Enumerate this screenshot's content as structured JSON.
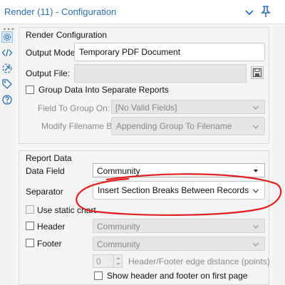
{
  "window": {
    "title": "Render (11) - Configuration"
  },
  "render_config": {
    "section_title": "Render Configuration",
    "output_mode_label": "Output Mode:",
    "output_mode_value": "Temporary PDF Document",
    "output_file_label": "Output File:",
    "output_file_value": "",
    "group_data_label": "Group Data Into Separate Reports",
    "group_data_checked": false,
    "field_to_group_label": "Field To Group On:",
    "field_to_group_value": "[No Valid Fields]",
    "modify_filename_label": "Modify Filename By:",
    "modify_filename_value": "Appending Group To Filename"
  },
  "report_data": {
    "section_title": "Report Data",
    "data_field_label": "Data Field",
    "data_field_value": "Community",
    "separator_label": "Separator",
    "separator_value": "Insert Section Breaks Between Records",
    "static_chart_label": "Use static chart",
    "static_chart_checked": false,
    "header_label": "Header",
    "header_checked": false,
    "header_value": "Community",
    "footer_label": "Footer",
    "footer_checked": false,
    "footer_value": "Community",
    "edge_distance_value": "0",
    "edge_distance_label": "Header/Footer edge distance (points)",
    "show_first_page_label": "Show header and footer on first page",
    "show_first_page_checked": false
  },
  "icons": {
    "left_strip": [
      "gear-icon",
      "code-icon",
      "arrow-circle-icon",
      "tag-icon",
      "help-icon"
    ],
    "title_bar": [
      "chevron-down-icon",
      "pin-icon"
    ],
    "annotation_color": "#e02020",
    "accent_color": "#2d6fb1"
  }
}
